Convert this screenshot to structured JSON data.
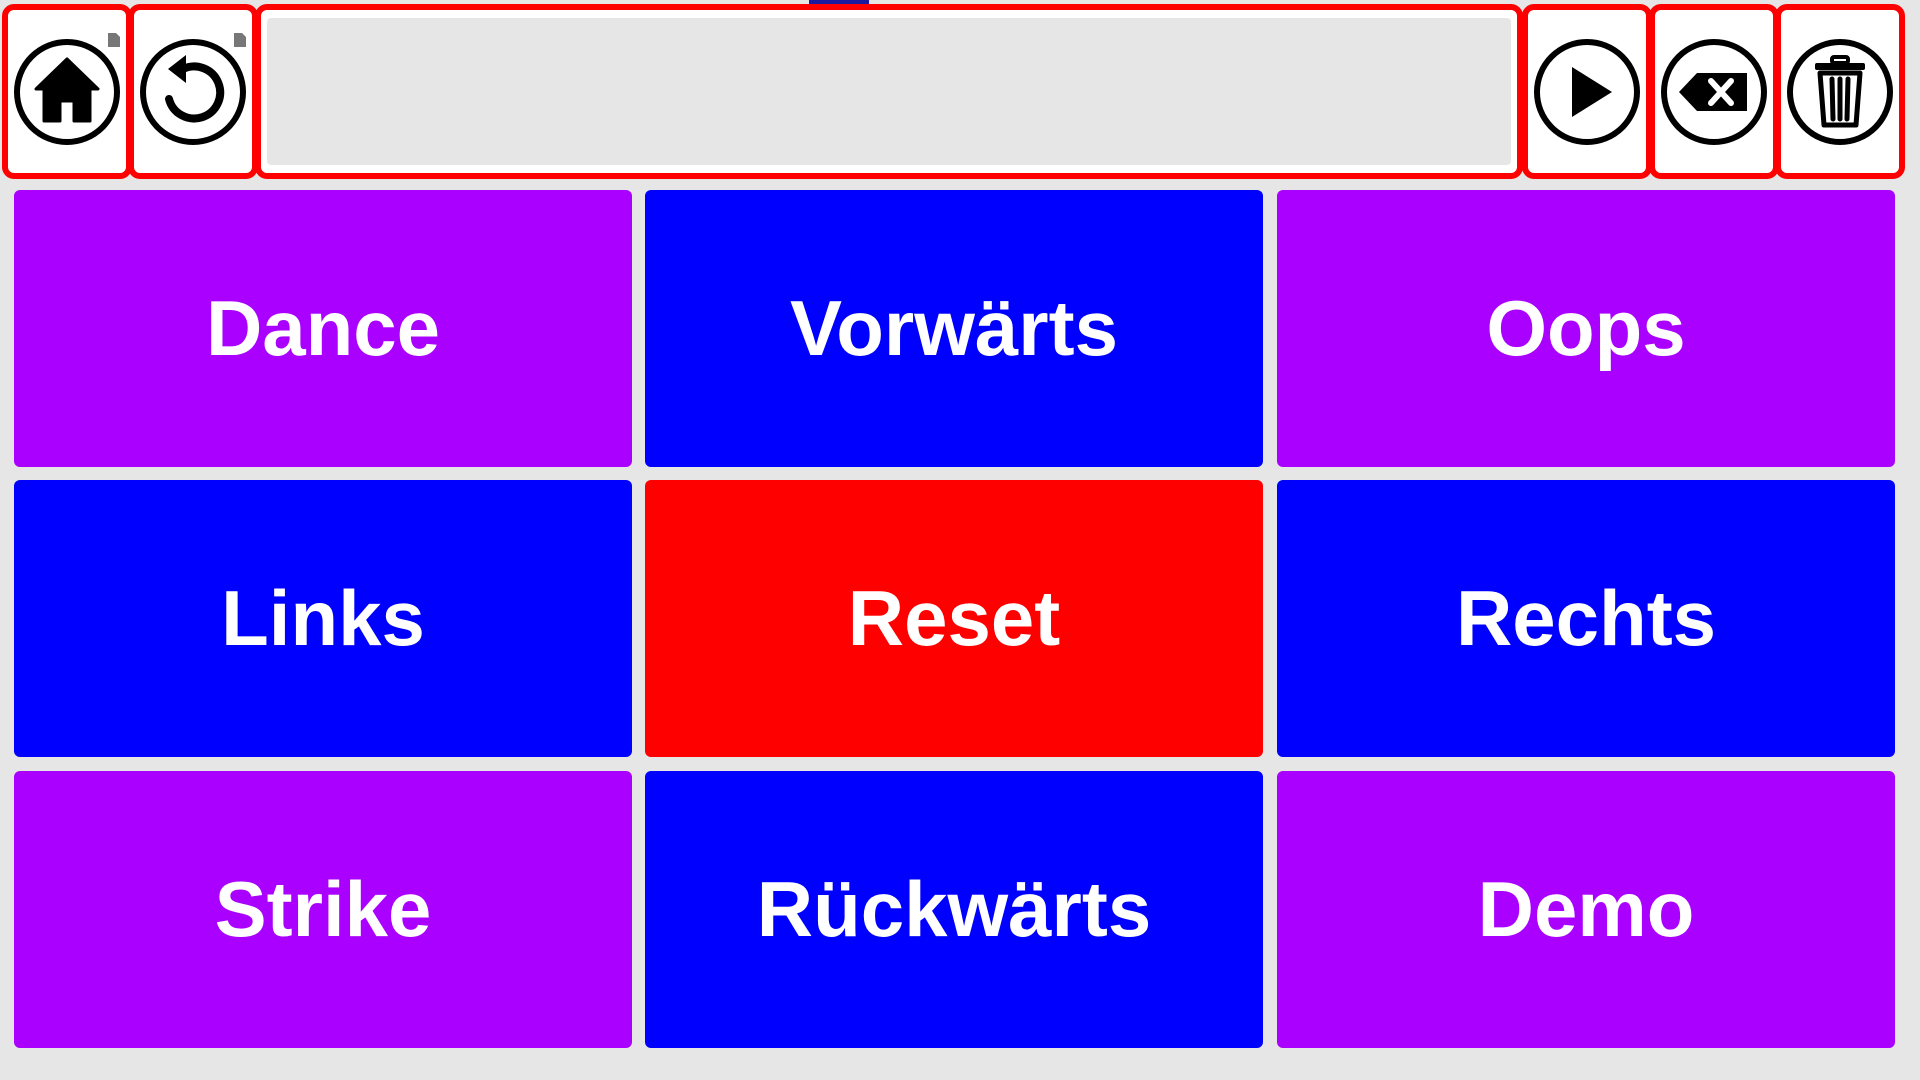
{
  "toolbar": {
    "home": {
      "icon": "home-icon"
    },
    "back": {
      "icon": "undo-arrow-icon"
    },
    "message": {
      "value": ""
    },
    "speak": {
      "icon": "play-icon"
    },
    "backspace": {
      "icon": "backspace-icon"
    },
    "clear": {
      "icon": "trash-icon"
    }
  },
  "colors": {
    "purple": "#aa00ff",
    "blue": "#0000ff",
    "red": "#ff0000",
    "highlight_border": "#ff0000",
    "background": "#e6e6e6"
  },
  "grid": [
    {
      "label": "Dance",
      "color": "#aa00ff"
    },
    {
      "label": "Vorwärts",
      "color": "#0000ff"
    },
    {
      "label": "Oops",
      "color": "#aa00ff"
    },
    {
      "label": "Links",
      "color": "#0000ff"
    },
    {
      "label": "Reset",
      "color": "#ff0000"
    },
    {
      "label": "Rechts",
      "color": "#0000ff"
    },
    {
      "label": "Strike",
      "color": "#aa00ff"
    },
    {
      "label": "Rückwärts",
      "color": "#0000ff"
    },
    {
      "label": "Demo",
      "color": "#aa00ff"
    }
  ]
}
